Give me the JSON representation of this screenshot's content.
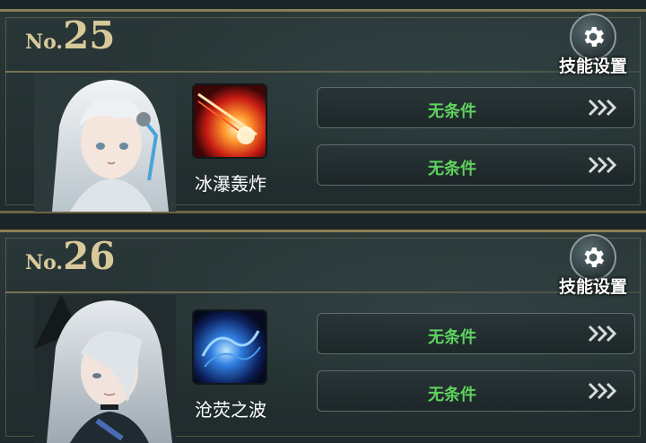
{
  "cards": [
    {
      "no_prefix": "No.",
      "no_number": "25",
      "settings_label": "技能设置",
      "skill_name": "冰瀑轰炸",
      "conditions": [
        "无条件",
        "无条件"
      ]
    },
    {
      "no_prefix": "No.",
      "no_number": "26",
      "settings_label": "技能设置",
      "skill_name": "沧荧之波",
      "conditions": [
        "无条件",
        "无条件"
      ]
    }
  ],
  "colors": {
    "gold": "#d8c99a",
    "condition_green": "#5fd35f",
    "panel_dark": "#1f2b2c"
  },
  "icons": [
    "gear-icon",
    "triple-chevron-icon",
    "character-portrait",
    "ice-bombard-skill-icon",
    "blue-wave-skill-icon"
  ]
}
